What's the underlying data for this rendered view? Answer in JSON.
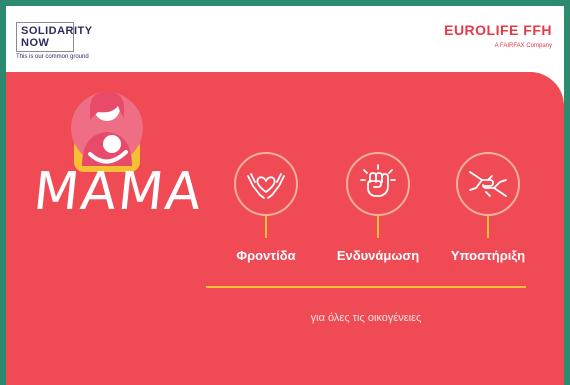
{
  "header": {
    "solidarity_logo": {
      "line1": "SOLIDARITY",
      "line2": "NOW",
      "tagline": "This is our common ground"
    },
    "eurolife_logo": {
      "name": "EUROLIFE FFH",
      "subtitle": "A FAIRFAX Company"
    }
  },
  "campaign": {
    "title": "MAMA",
    "tagline": "για όλες τις οικογένειες"
  },
  "features": [
    {
      "label": "Φροντίδα",
      "icon": "hands-heart-icon"
    },
    {
      "label": "Ενδυνάμωση",
      "icon": "raised-fist-icon"
    },
    {
      "label": "Υποστήριξη",
      "icon": "helping-hands-icon"
    }
  ],
  "colors": {
    "background_frame": "#2c8a70",
    "panel": "#f04a55",
    "accent_yellow": "#f7c033",
    "icon_outline": "#f5b0a0",
    "brand_red": "#e63946",
    "brand_navy": "#2c2c5e"
  }
}
